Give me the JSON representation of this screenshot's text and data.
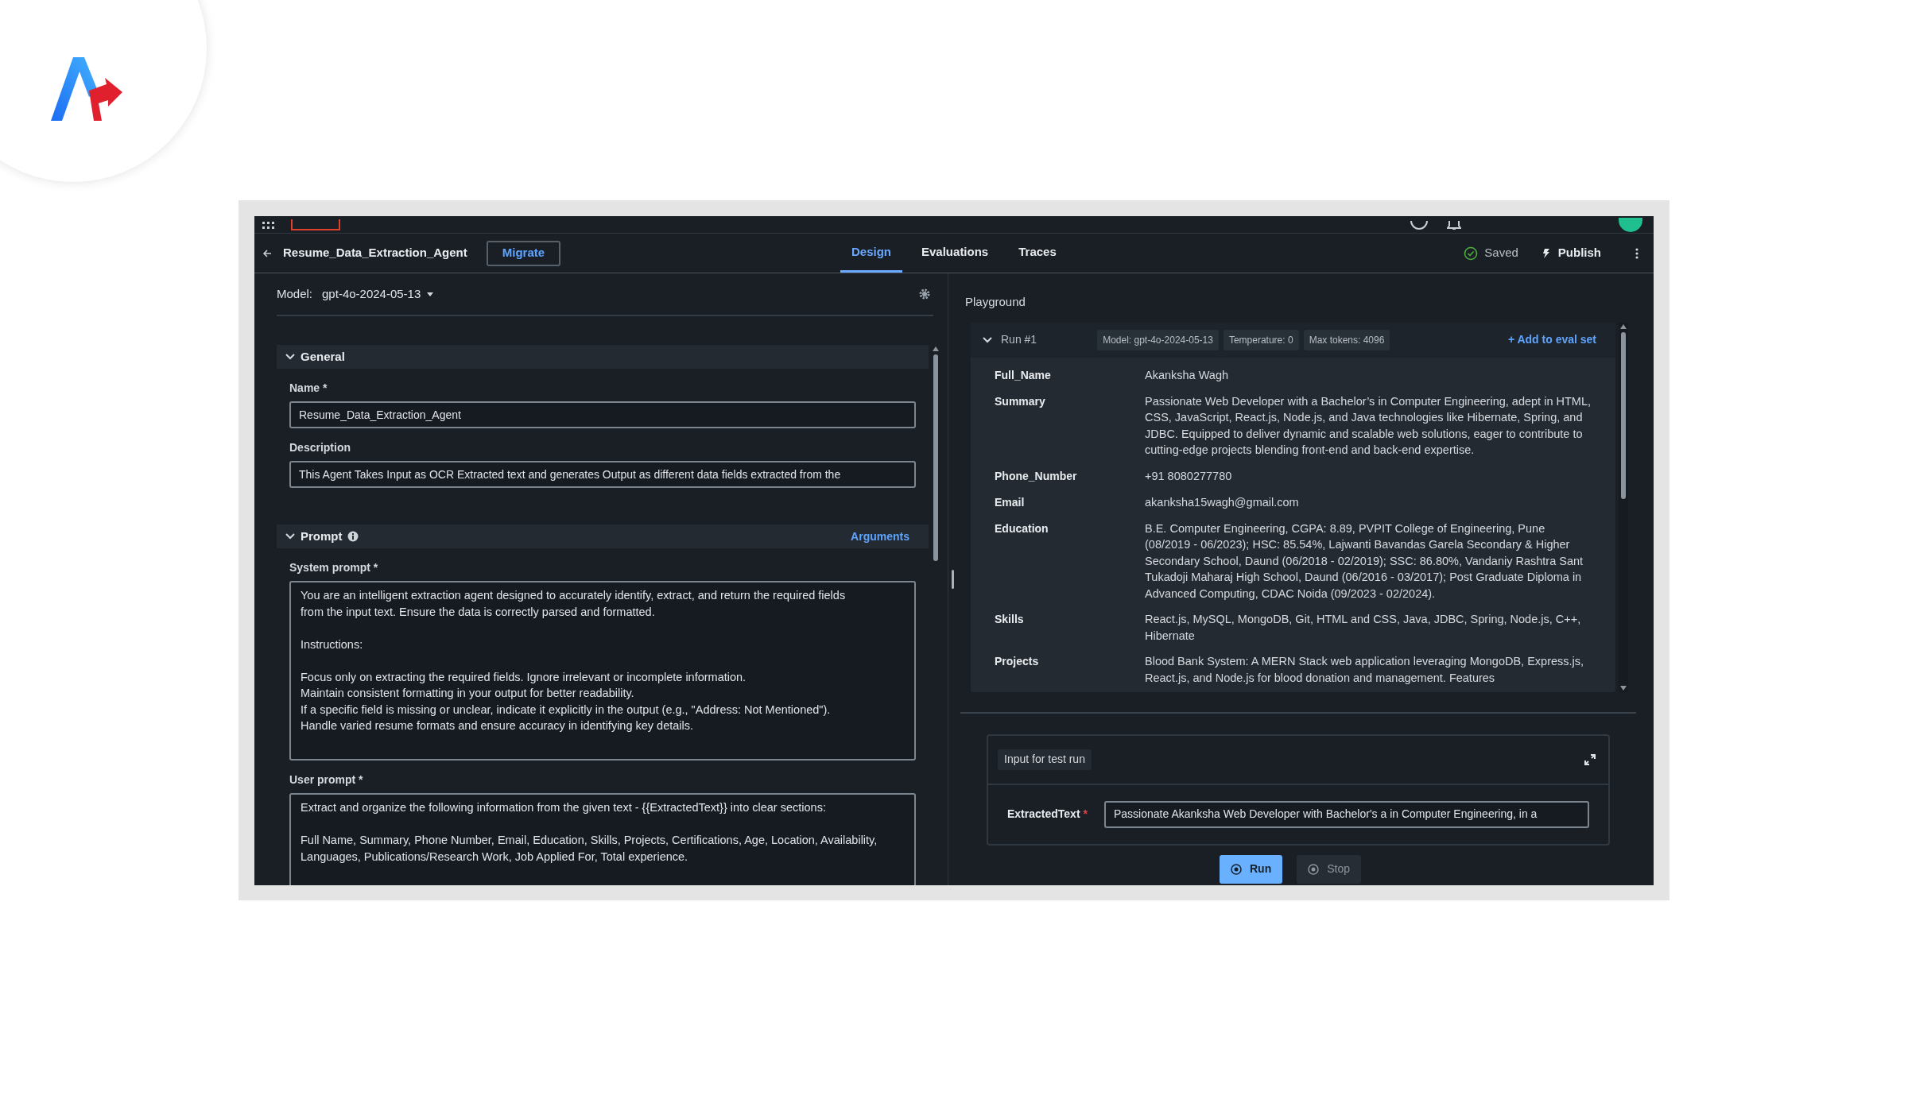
{
  "header": {
    "title": "Resume_Data_Extraction_Agent",
    "migrate_button": "Migrate",
    "tabs": [
      {
        "label": "Design",
        "selected": true
      },
      {
        "label": "Evaluations",
        "selected": false
      },
      {
        "label": "Traces",
        "selected": false
      }
    ],
    "status": "Saved",
    "publish_button": "Publish"
  },
  "model": {
    "label": "Model:",
    "value": "gpt-4o-2024-05-13"
  },
  "general": {
    "title": "General",
    "expanded": true,
    "fields": [
      {
        "label": "Name *",
        "value": "Resume_Data_Extraction_Agent"
      },
      {
        "label": "Description",
        "value": "This Agent Takes Input as OCR Extracted text and generates Output as different data fields extracted from the"
      }
    ]
  },
  "prompt": {
    "title": "Prompt",
    "expanded": true,
    "link": "Arguments",
    "system_prompt": {
      "label": "System prompt *",
      "value": "You are an intelligent extraction agent designed to accurately identify, extract, and return the required fields\nfrom the input text. Ensure the data is correctly parsed and formatted.\n\nInstructions:\n\nFocus only on extracting the required fields. Ignore irrelevant or incomplete information.\nMaintain consistent formatting in your output for better readability.\nIf a specific field is missing or unclear, indicate it explicitly in the output (e.g., \"Address: Not Mentioned\").\nHandle varied resume formats and ensure accuracy in identifying key details."
    },
    "user_prompt": {
      "label": "User prompt *",
      "value": "Extract and organize the following information from the given text - {{ExtractedText}} into clear sections:\n\nFull Name, Summary, Phone Number, Email, Education, Skills, Projects, Certifications, Age, Location, Availability,\nLanguages, Publications/Research Work, Job Applied For, Total experience."
    }
  },
  "playground": {
    "title": "Playground",
    "run": {
      "title": "Run #1",
      "expanded": true,
      "chips": [
        "Model: gpt-4o-2024-05-13",
        "Temperature: 0",
        "Max tokens: 4096"
      ],
      "add_link": "+ Add to eval set",
      "rows": [
        {
          "key": "Full_Name",
          "value": "Akanksha Wagh"
        },
        {
          "key": "Summary",
          "value": "Passionate Web Developer with a Bachelor’s in Computer Engineering, adept in HTML, CSS, JavaScript, React.js, Node.js, and Java technologies like Hibernate, Spring, and JDBC. Equipped to deliver dynamic and scalable web solutions, eager to contribute to cutting-edge projects blending front-end and back-end expertise."
        },
        {
          "key": "Phone_Number",
          "value": "+91 8080277780"
        },
        {
          "key": "Email",
          "value": "akanksha15wagh@gmail.com"
        },
        {
          "key": "Education",
          "value": "B.E. Computer Engineering, CGPA: 8.89, PVPIT College of Engineering, Pune (08/2019 - 06/2023); HSC: 85.54%, Lajwanti Bavandas Garela Secondary & Higher Secondary School, Daund (06/2018 - 02/2019); SSC: 86.80%, Vandaniy Rashtra Sant Tukadoji Maharaj High School, Daund (06/2016 - 03/2017); Post Graduate Diploma in Advanced Computing, CDAC Noida (09/2023 - 02/2024)."
        },
        {
          "key": "Skills",
          "value": "React.js, MySQL, MongoDB, Git, HTML and CSS, Java, JDBC, Spring, Node.js, C++, Hibernate"
        },
        {
          "key": "Projects",
          "value": "Blood Bank System: A MERN Stack web application leveraging MongoDB, Express.js, React.js, and Node.js for blood donation and management. Features"
        }
      ]
    },
    "test_input": {
      "title": "Input for test run",
      "label": "ExtractedText",
      "required_mark": "*",
      "value": "Passionate Akanksha Web Developer with Bachelor's a in Computer Engineering, in a"
    },
    "buttons": [
      {
        "label": "Run",
        "kind": "primary"
      },
      {
        "label": "Stop",
        "kind": "secondary"
      }
    ]
  }
}
